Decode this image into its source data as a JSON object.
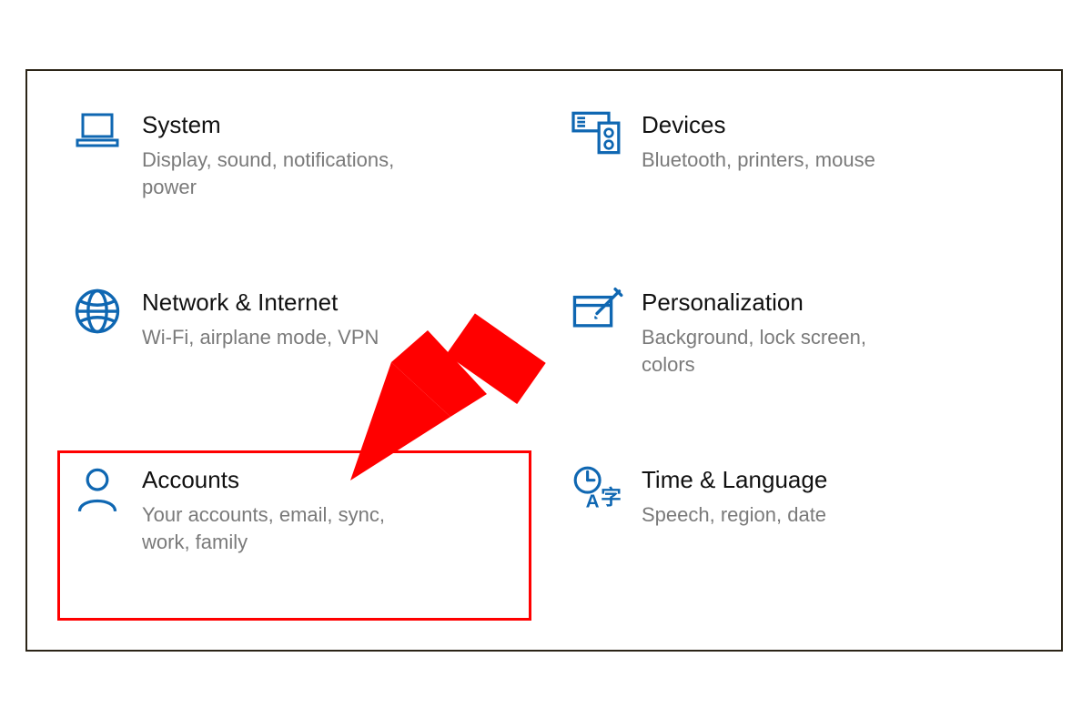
{
  "colors": {
    "icon": "#0f67b2",
    "highlight": "#ff0000",
    "desc": "#7a7a7a"
  },
  "tiles": [
    {
      "key": "system",
      "title": "System",
      "desc": "Display, sound, notifications, power",
      "icon": "laptop-icon",
      "highlight": false
    },
    {
      "key": "devices",
      "title": "Devices",
      "desc": "Bluetooth, printers, mouse",
      "icon": "devices-icon",
      "highlight": false
    },
    {
      "key": "network",
      "title": "Network & Internet",
      "desc": "Wi-Fi, airplane mode, VPN",
      "icon": "globe-icon",
      "highlight": false
    },
    {
      "key": "personalization",
      "title": "Personalization",
      "desc": "Background, lock screen, colors",
      "icon": "personalize-icon",
      "highlight": false
    },
    {
      "key": "accounts",
      "title": "Accounts",
      "desc": "Your accounts, email, sync, work, family",
      "icon": "person-icon",
      "highlight": true
    },
    {
      "key": "time-language",
      "title": "Time & Language",
      "desc": "Speech, region, date",
      "icon": "time-language-icon",
      "highlight": false
    }
  ],
  "annotation": {
    "type": "arrow",
    "points_to": "accounts",
    "color": "#ff0000"
  }
}
